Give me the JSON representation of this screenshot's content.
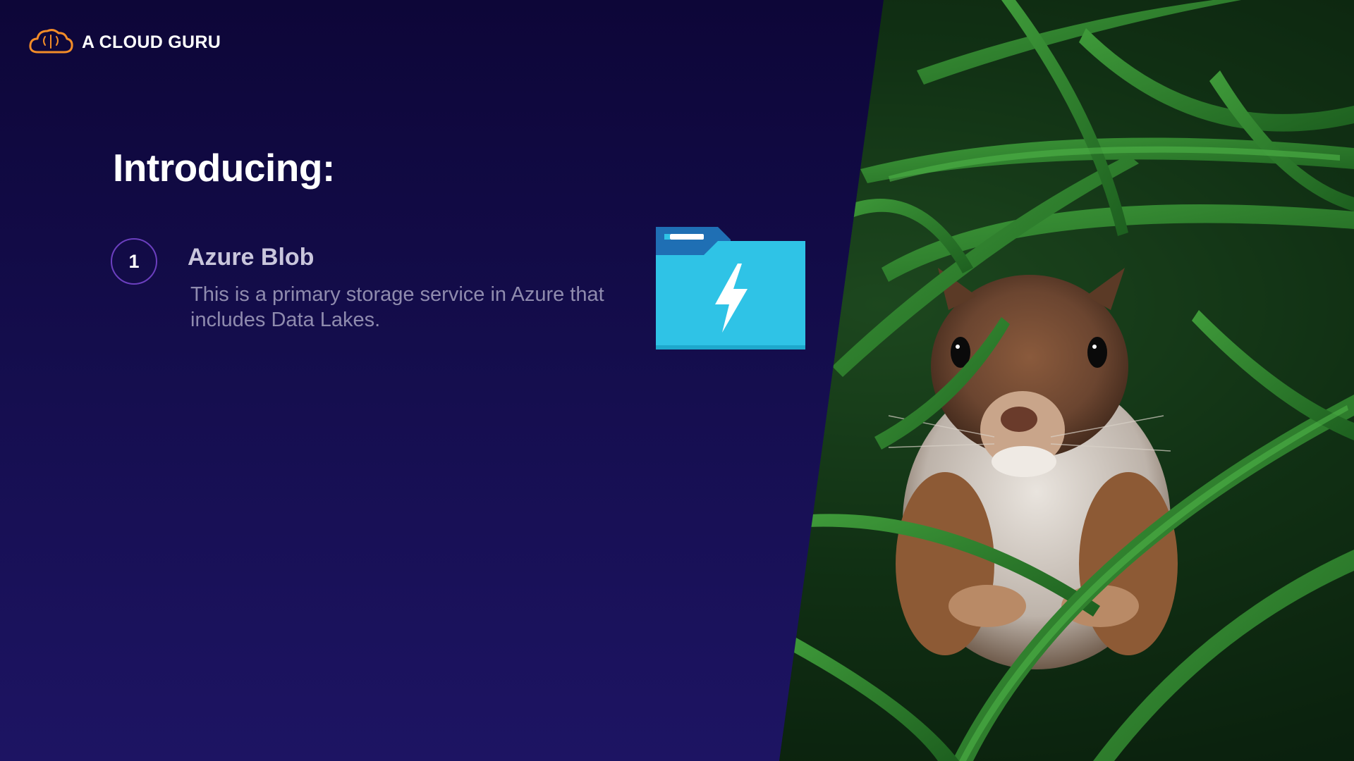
{
  "brand": {
    "name": "A CLOUD GURU",
    "logo_icon": "cloud-brain-icon",
    "accent_color": "#f28c28"
  },
  "slide": {
    "title": "Introducing:",
    "items": [
      {
        "number": "1",
        "title": "Azure Blob",
        "description": "This is a primary storage service in Azure that includes Data Lakes.",
        "icon": "storage-folder-lightning-icon"
      }
    ]
  },
  "colors": {
    "background": "#140d4c",
    "number_ring": "#6b3fbf",
    "folder_main": "#2fc3e6",
    "folder_tab": "#1f6fb4"
  },
  "photo": {
    "subject": "squirrel-in-grass-image"
  }
}
